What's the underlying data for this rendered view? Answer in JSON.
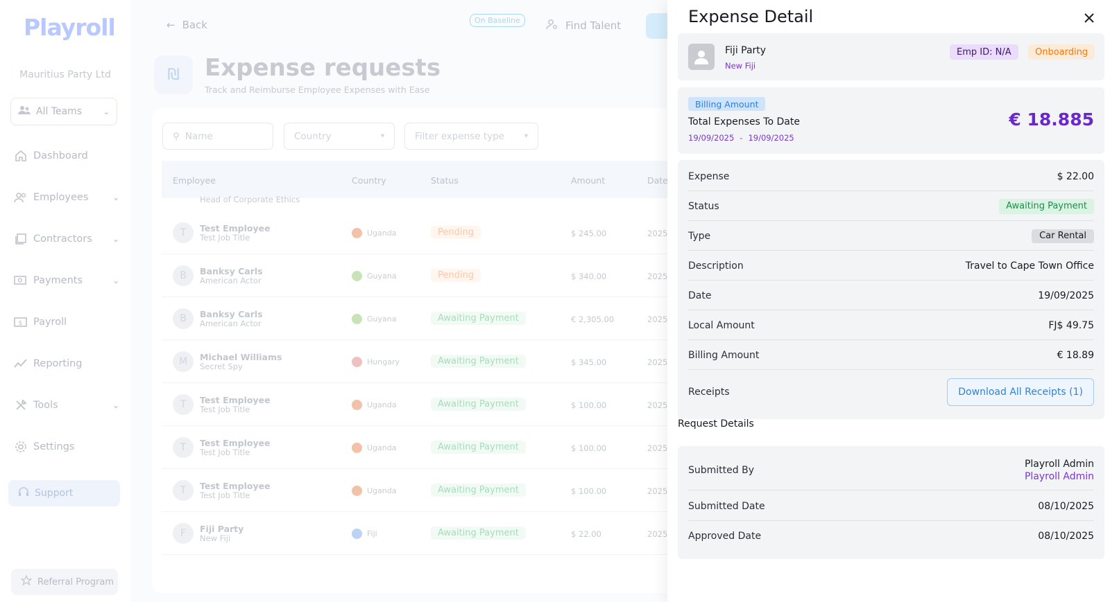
{
  "app": {
    "logo": "Playroll",
    "company": "Mauritius Party Ltd",
    "teams_select": "All Teams",
    "nav": [
      {
        "label": "Dashboard",
        "icon": "home-icon"
      },
      {
        "label": "Employees",
        "icon": "users-icon"
      },
      {
        "label": "Contractors",
        "icon": "contractors-icon"
      },
      {
        "label": "Payments",
        "icon": "payments-icon"
      },
      {
        "label": "Payroll",
        "icon": "payroll-icon"
      },
      {
        "label": "Reporting",
        "icon": "chart-line-icon"
      },
      {
        "label": "Tools",
        "icon": "tools-icon"
      },
      {
        "label": "Settings",
        "icon": "gear-icon"
      }
    ],
    "support": "Support",
    "referral": "Referral Program"
  },
  "header": {
    "back": "Back",
    "baseline_badge": "On Baseline",
    "find_talent": "Find Talent"
  },
  "page": {
    "title": "Expense requests",
    "subtitle": "Track and Reimburse Employee Expenses with Ease",
    "filters": {
      "name_placeholder": "Name",
      "country_placeholder": "Country",
      "expense_type_placeholder": "Filter expense type"
    },
    "columns": [
      "Employee",
      "Country",
      "Status",
      "Amount",
      "Date"
    ],
    "partial_row_job": "Head of Corporate Ethics",
    "rows": [
      {
        "initial": "T",
        "name": "Test Employee",
        "job": "Test Job Title",
        "country": "Uganda",
        "status": "Pending",
        "amount": "$ 245.00",
        "date": "2025"
      },
      {
        "initial": "B",
        "name": "Banksy Carls",
        "job": "American Actor",
        "country": "Guyana",
        "status": "Pending",
        "amount": "$ 340.00",
        "date": "2025"
      },
      {
        "initial": "B",
        "name": "Banksy Carls",
        "job": "American Actor",
        "country": "Guyana",
        "status": "Awaiting Payment",
        "amount": "€ 2,305.00",
        "date": "2025"
      },
      {
        "initial": "M",
        "name": "Michael Williams",
        "job": "Secret Spy",
        "country": "Hungary",
        "status": "Awaiting Payment",
        "amount": "$ 345.00",
        "date": "2025"
      },
      {
        "initial": "T",
        "name": "Test Employee",
        "job": "Test Job Title",
        "country": "Uganda",
        "status": "Awaiting Payment",
        "amount": "$ 100.00",
        "date": "2025"
      },
      {
        "initial": "T",
        "name": "Test Employee",
        "job": "Test Job Title",
        "country": "Uganda",
        "status": "Awaiting Payment",
        "amount": "$ 100.00",
        "date": "2025"
      },
      {
        "initial": "T",
        "name": "Test Employee",
        "job": "Test Job Title",
        "country": "Uganda",
        "status": "Awaiting Payment",
        "amount": "$ 100.00",
        "date": "2025"
      },
      {
        "initial": "F",
        "name": "Fiji Party",
        "job": "New Fiji",
        "country": "Fiji",
        "status": "Awaiting Payment",
        "amount": "$ 22.00",
        "date": "2025"
      }
    ]
  },
  "drawer": {
    "title": "Expense Detail",
    "employee": {
      "name": "Fiji Party",
      "subtitle": "New Fiji",
      "emp_id": "Emp ID: N/A",
      "status": "Onboarding"
    },
    "billing": {
      "badge": "Billing Amount",
      "label": "Total Expenses To Date",
      "from": "19/09/2025",
      "separator": "-",
      "to": "19/09/2025",
      "total": "€ 18.885"
    },
    "details": {
      "expense_label": "Expense",
      "expense_value": "$ 22.00",
      "status_label": "Status",
      "status_value": "Awaiting Payment",
      "type_label": "Type",
      "type_value": "Car Rental",
      "description_label": "Description",
      "description_value": "Travel to Cape Town Office",
      "date_label": "Date",
      "date_value": "19/09/2025",
      "local_label": "Local Amount",
      "local_value": "FJ$ 49.75",
      "billing_label": "Billing Amount",
      "billing_value": "€ 18.89",
      "receipts_label": "Receipts",
      "receipts_button": "Download All Receipts (1)"
    },
    "request": {
      "title": "Request Details",
      "submitted_by_label": "Submitted By",
      "submitted_by_name": "Playroll Admin",
      "submitted_by_role": "Playroll Admin",
      "submitted_date_label": "Submitted Date",
      "submitted_date": "08/10/2025",
      "approved_date_label": "Approved Date",
      "approved_date": "08/10/2025"
    }
  },
  "colors": {
    "accent_purple": "#6a27c9",
    "awaiting_green": "#1d8d4c",
    "onboarding_orange": "#f07a0c",
    "link_blue": "#2f83d8"
  }
}
